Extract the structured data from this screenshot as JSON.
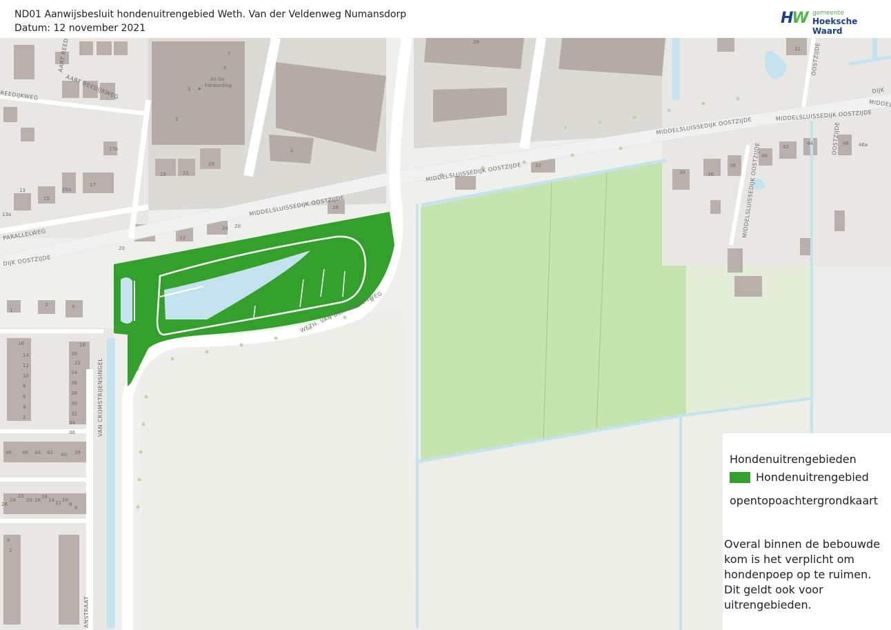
{
  "header": {
    "title": "ND01 Aanwijsbesluit hondenuitrengebied Weth. Van der Veldenweg Numansdorp",
    "date": "Datum: 12 november 2021"
  },
  "logo": {
    "mark_h": "H",
    "mark_w": "W",
    "small_text": "gemeente",
    "big_text": "Hoeksche Waard"
  },
  "map": {
    "street_labels": {
      "middelsluissedijk_main": "MIDDELSLUISSEDIJK OOSTZIJDE",
      "middelsluissedijk_center": "MIDDELSLUISSEDIJK OOSTZIJDE",
      "middelsluissedijk_top": "MIDDELSLUISSEDIJK OOSTZIJDE",
      "middelsluissedijk_left": "DIJK OOSTZIJDE",
      "middelsluissedijk_east": "MIDDELSLUISSEDIJK OOSTZIJDE",
      "veldenweg": "WETH. VAN DER VELDENWEG",
      "parallelweg": "PARALLELWEG",
      "aart_reedijkweg_1": "AART REEDIJKWEG",
      "aart_reedijkweg_2": "AART REEDIJKWEG",
      "reedijkweg": "REEDIJKWEG",
      "cromstrijensingel": "VAN CROMSTRIJENSINGEL",
      "anstraat": "ANSTRAAT",
      "middelsluissedijk_vertical": "MIDDELSLUISSEDIJK OOSTZIJDE",
      "oostzijde_right": "OOSTZIJDE",
      "middel_edge": "MIDDEL",
      "oostzijde_top": "OOSTZIJDE",
      "dijk_edge": "DIJK"
    },
    "poi": {
      "name_line1": "All Go",
      "name_line2": "Forwarding"
    },
    "house_numbers": [
      "7",
      "5",
      "3",
      "1",
      "2",
      "28",
      "17a",
      "17",
      "15",
      "13",
      "19",
      "21",
      "23",
      "25a",
      "13a",
      "28",
      "24",
      "20",
      "22",
      "20",
      "1",
      "3",
      "5",
      "16",
      "14",
      "12",
      "10",
      "8",
      "6",
      "4",
      "2",
      "18",
      "20",
      "22",
      "24",
      "26",
      "28",
      "30",
      "32",
      "34",
      "36",
      "48",
      "46",
      "44",
      "42",
      "40",
      "38",
      "26",
      "24",
      "22",
      "20",
      "18",
      "16",
      "14",
      "12",
      "10",
      "8",
      "6",
      "4",
      "2",
      "11",
      "34",
      "36",
      "38",
      "40",
      "42",
      "44",
      "46",
      "46a",
      "32"
    ]
  },
  "legend": {
    "title": "Hondenuitrengebieden",
    "item_label": "Hondenuitrengebied",
    "item_color": "#33a02c",
    "basemap": "opentopoachtergrondkaart",
    "note": "Overal binnen de bebouwde\nkom is het verplicht om\nhondenpoep op te ruimen.\n Dit geldt ook voor\nuitrengebieden."
  }
}
